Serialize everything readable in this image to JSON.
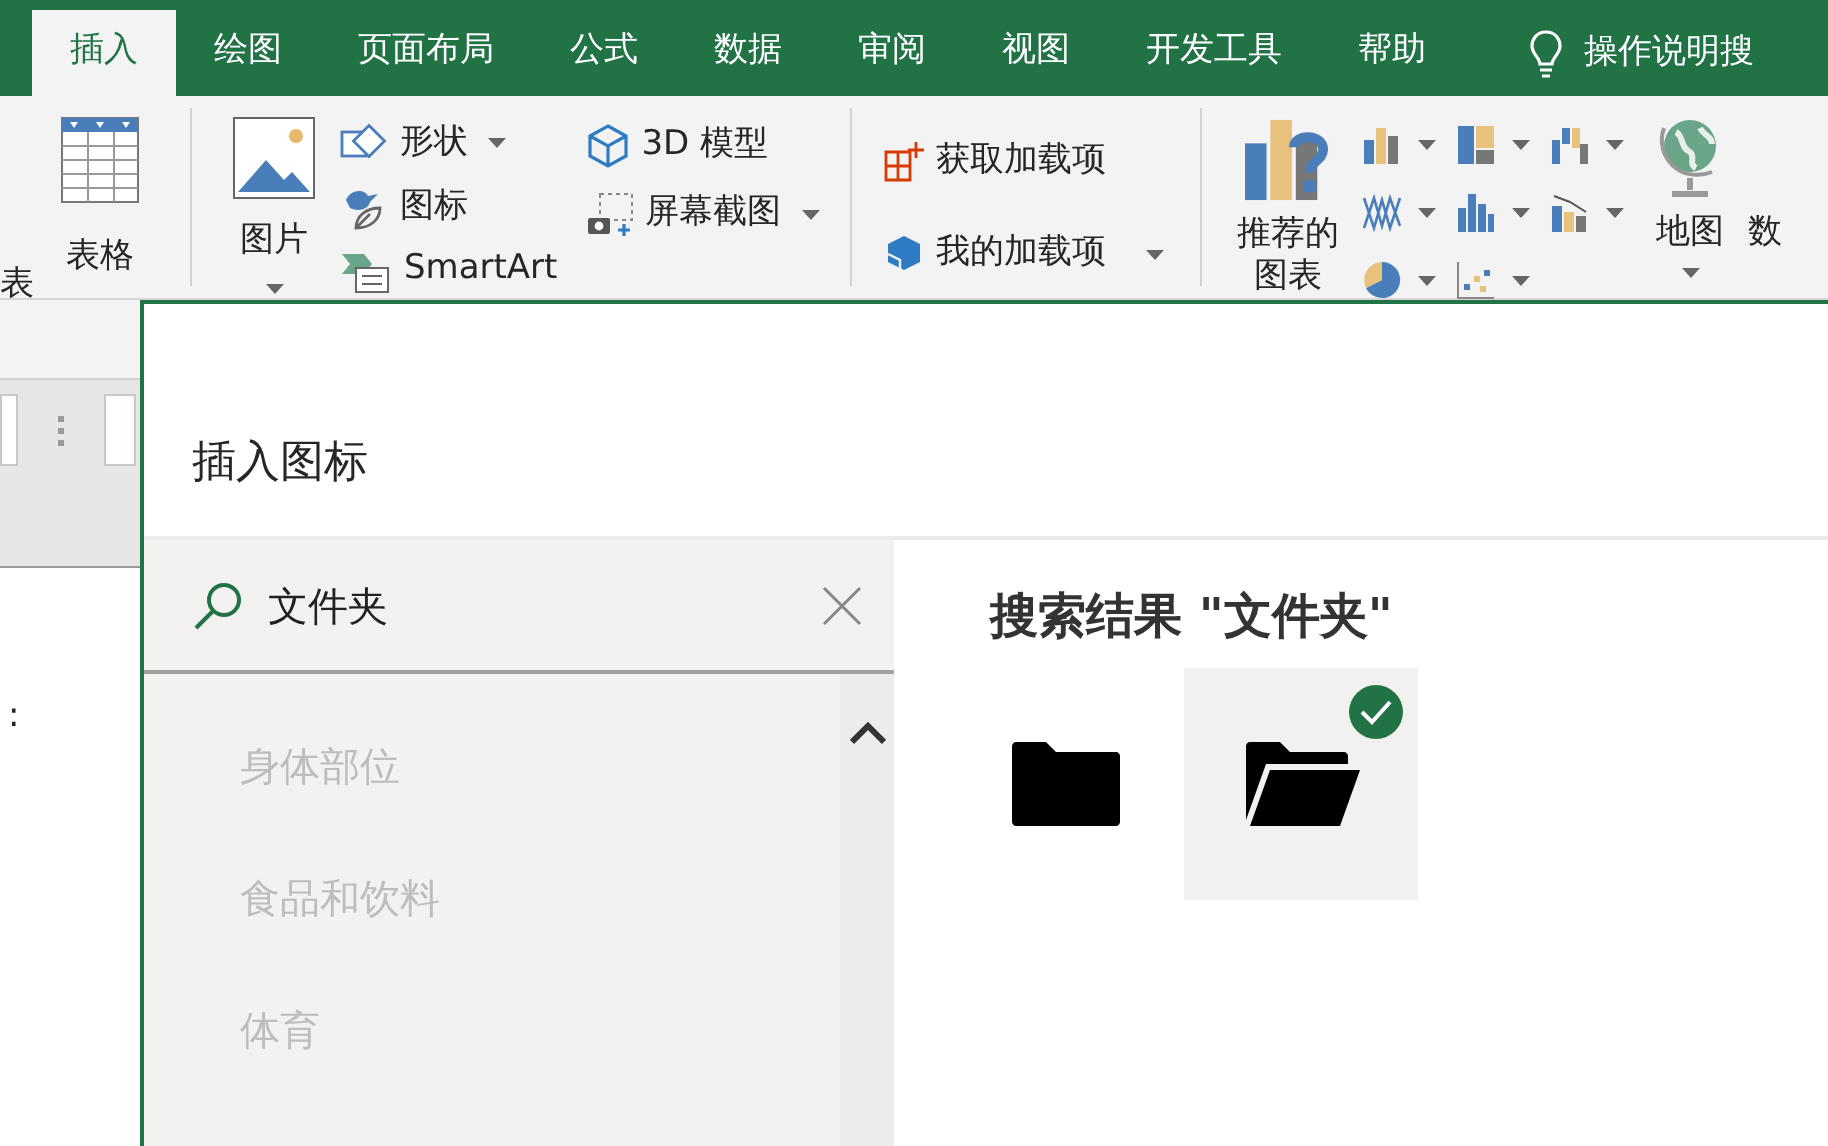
{
  "tabs": [
    {
      "label": "插入",
      "selected": true
    },
    {
      "label": "绘图",
      "selected": false
    },
    {
      "label": "页面布局",
      "selected": false
    },
    {
      "label": "公式",
      "selected": false
    },
    {
      "label": "数据",
      "selected": false
    },
    {
      "label": "审阅",
      "selected": false
    },
    {
      "label": "视图",
      "selected": false
    },
    {
      "label": "开发工具",
      "selected": false
    },
    {
      "label": "帮助",
      "selected": false
    }
  ],
  "tell_me": {
    "label": "操作说明搜"
  },
  "ribbon": {
    "tables": {
      "cut_label": "表",
      "table": {
        "label": "表格"
      }
    },
    "illustrations": {
      "pictures": {
        "label": "图片",
        "has_menu": true
      },
      "column_1": [
        {
          "label": "形状",
          "has_menu": true
        },
        {
          "label": "图标",
          "has_menu": false
        },
        {
          "label": "SmartArt",
          "has_menu": false
        }
      ],
      "column_2": [
        {
          "label": "3D 模型",
          "has_menu": false
        },
        {
          "label": "屏幕截图",
          "has_menu": true
        }
      ]
    },
    "addins": [
      {
        "label": "获取加载项",
        "has_menu": false
      },
      {
        "label": "我的加载项",
        "has_menu": true
      }
    ],
    "charts": {
      "recommended": {
        "label": "推荐的图表"
      },
      "maps": {
        "label": "地图",
        "has_menu": true
      },
      "cut_label": "数"
    }
  },
  "sheet": {
    "cell_text": ":"
  },
  "dialog": {
    "title": "插入图标",
    "search": {
      "value": "文件夹"
    },
    "categories": [
      {
        "label": "身体部位",
        "disabled": true
      },
      {
        "label": "食品和饮料",
        "disabled": true
      },
      {
        "label": "体育",
        "disabled": true
      }
    ],
    "results_heading": "搜索结果 \"文件夹\"",
    "results": [
      {
        "selected": false
      },
      {
        "selected": true
      }
    ]
  }
}
